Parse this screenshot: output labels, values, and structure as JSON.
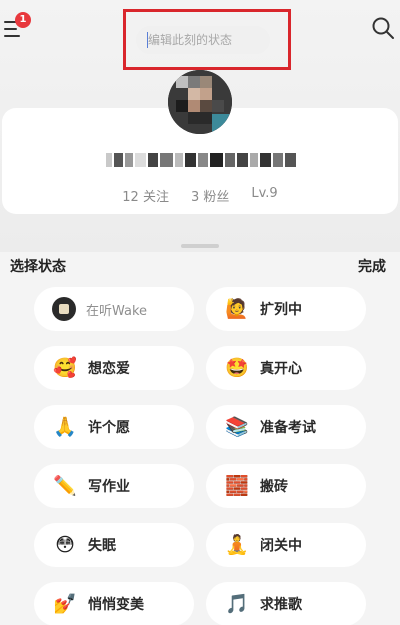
{
  "header": {
    "notification_count": "1",
    "status_placeholder": "编辑此刻的状态",
    "menu_icon": "menu-icon",
    "search_icon": "search-icon"
  },
  "profile": {
    "following": "12 关注",
    "followers": "3 粉丝",
    "level": "Lv.9"
  },
  "status_panel": {
    "title": "选择状态",
    "done_label": "完成",
    "items": [
      {
        "label": "在听Wake",
        "emoji": "wake-cover-icon"
      },
      {
        "label": "扩列中",
        "emoji": "🙋"
      },
      {
        "label": "想恋爱",
        "emoji": "🥰"
      },
      {
        "label": "真开心",
        "emoji": "🤩"
      },
      {
        "label": "许个愿",
        "emoji": "🙏"
      },
      {
        "label": "准备考试",
        "emoji": "📚"
      },
      {
        "label": "写作业",
        "emoji": "✏️"
      },
      {
        "label": "搬砖",
        "emoji": "🧱"
      },
      {
        "label": "失眠",
        "emoji": "😳"
      },
      {
        "label": "闭关中",
        "emoji": "🧘"
      },
      {
        "label": "悄悄变美",
        "emoji": "💅"
      },
      {
        "label": "求推歌",
        "emoji": "🎵"
      }
    ]
  },
  "colors": {
    "badge": "#e8383d",
    "highlight_border": "#d9262c",
    "cursor": "#5a7fd6"
  }
}
